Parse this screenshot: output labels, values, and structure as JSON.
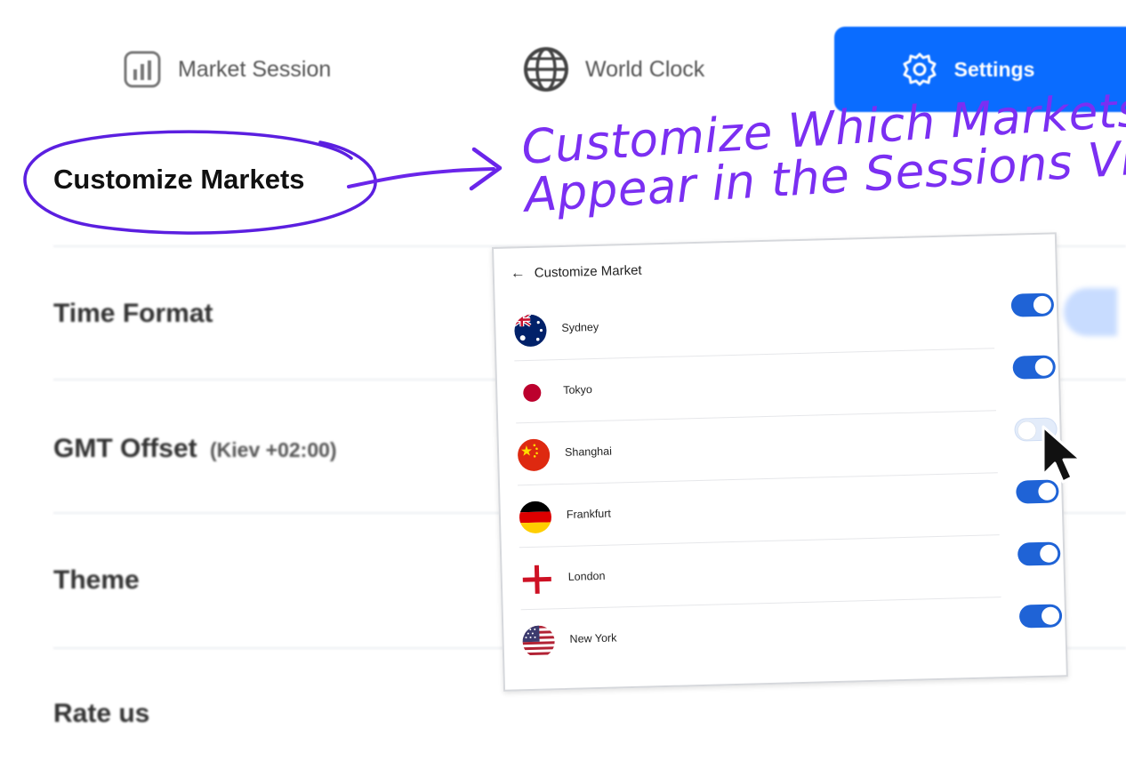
{
  "tabs": [
    {
      "label": "Market Session",
      "icon": "chart-icon",
      "active": false
    },
    {
      "label": "World Clock",
      "icon": "globe-icon",
      "active": false
    },
    {
      "label": "Settings",
      "icon": "gear-icon",
      "active": true
    }
  ],
  "settings": {
    "customize_markets": "Customize Markets",
    "time_format": "Time Format",
    "gmt_offset": "GMT Offset",
    "gmt_offset_value": "(Kiev +02:00)",
    "theme": "Theme",
    "rate_us": "Rate us"
  },
  "annotation": {
    "headline_line1": "Customize Which Markets",
    "headline_line2": "Appear in the Sessions View"
  },
  "panel": {
    "title": "Customize Market",
    "back_icon": "←",
    "markets": [
      {
        "name": "Sydney",
        "flag": "australia",
        "enabled": true
      },
      {
        "name": "Tokyo",
        "flag": "japan",
        "enabled": true
      },
      {
        "name": "Shanghai",
        "flag": "china",
        "enabled": false
      },
      {
        "name": "Frankfurt",
        "flag": "germany",
        "enabled": true
      },
      {
        "name": "London",
        "flag": "england",
        "enabled": true
      },
      {
        "name": "New York",
        "flag": "usa",
        "enabled": true
      }
    ]
  },
  "colors": {
    "accent": "#0a6cff",
    "toggle_on": "#1f63d6",
    "annotation": "#7b2ff2"
  }
}
